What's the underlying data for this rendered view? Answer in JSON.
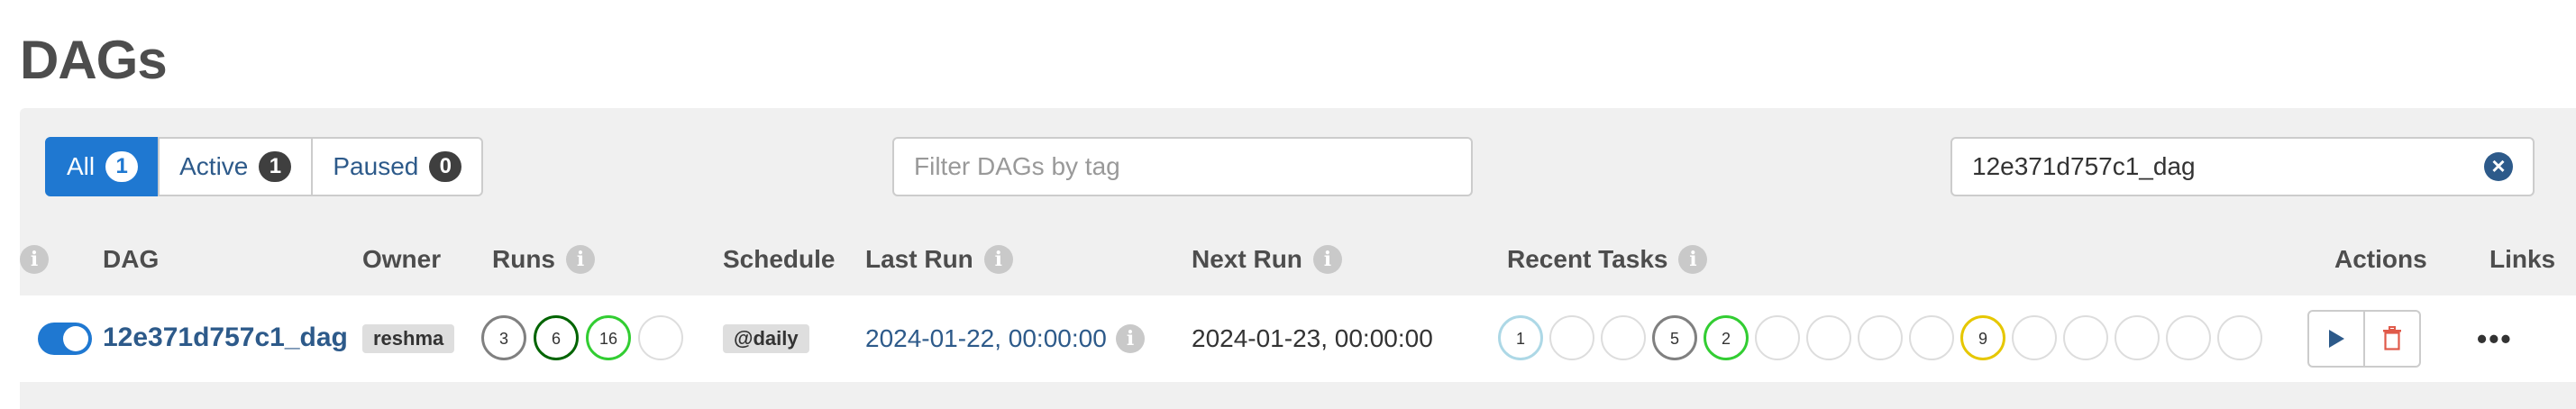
{
  "page": {
    "title": "DAGs"
  },
  "filters": {
    "tabs": [
      {
        "label": "All",
        "count": "1"
      },
      {
        "label": "Active",
        "count": "1"
      },
      {
        "label": "Paused",
        "count": "0"
      }
    ],
    "tag_placeholder": "Filter DAGs by tag",
    "search_value": "12e371d757c1_dag"
  },
  "table": {
    "headers": {
      "dag": "DAG",
      "owner": "Owner",
      "runs": "Runs",
      "schedule": "Schedule",
      "last_run": "Last Run",
      "next_run": "Next Run",
      "recent_tasks": "Recent Tasks",
      "actions": "Actions",
      "links": "Links"
    },
    "rows": [
      {
        "active": true,
        "dag_id": "12e371d757c1_dag",
        "owner": "reshma",
        "runs": [
          {
            "count": "3",
            "color": "#808080"
          },
          {
            "count": "6",
            "color": "#006400"
          },
          {
            "count": "16",
            "color": "#32cd32"
          },
          {
            "count": "",
            "color": "#dddddd"
          }
        ],
        "schedule": "@daily",
        "last_run": "2024-01-22, 00:00:00",
        "next_run": "2024-01-23, 00:00:00",
        "recent_tasks": [
          {
            "count": "1",
            "color": "#add8e6"
          },
          {
            "count": "",
            "color": "#dddddd"
          },
          {
            "count": "",
            "color": "#dddddd"
          },
          {
            "count": "5",
            "color": "#808080"
          },
          {
            "count": "2",
            "color": "#32cd32"
          },
          {
            "count": "",
            "color": "#dddddd"
          },
          {
            "count": "",
            "color": "#dddddd"
          },
          {
            "count": "",
            "color": "#dddddd"
          },
          {
            "count": "",
            "color": "#dddddd"
          },
          {
            "count": "9",
            "color": "#e6c700"
          },
          {
            "count": "",
            "color": "#dddddd"
          },
          {
            "count": "",
            "color": "#dddddd"
          },
          {
            "count": "",
            "color": "#dddddd"
          },
          {
            "count": "",
            "color": "#dddddd"
          },
          {
            "count": "",
            "color": "#dddddd"
          }
        ],
        "actions": {
          "trigger_icon": "play-icon",
          "delete_icon": "trash-icon"
        },
        "links_icon": "ellipsis-icon"
      }
    ]
  }
}
